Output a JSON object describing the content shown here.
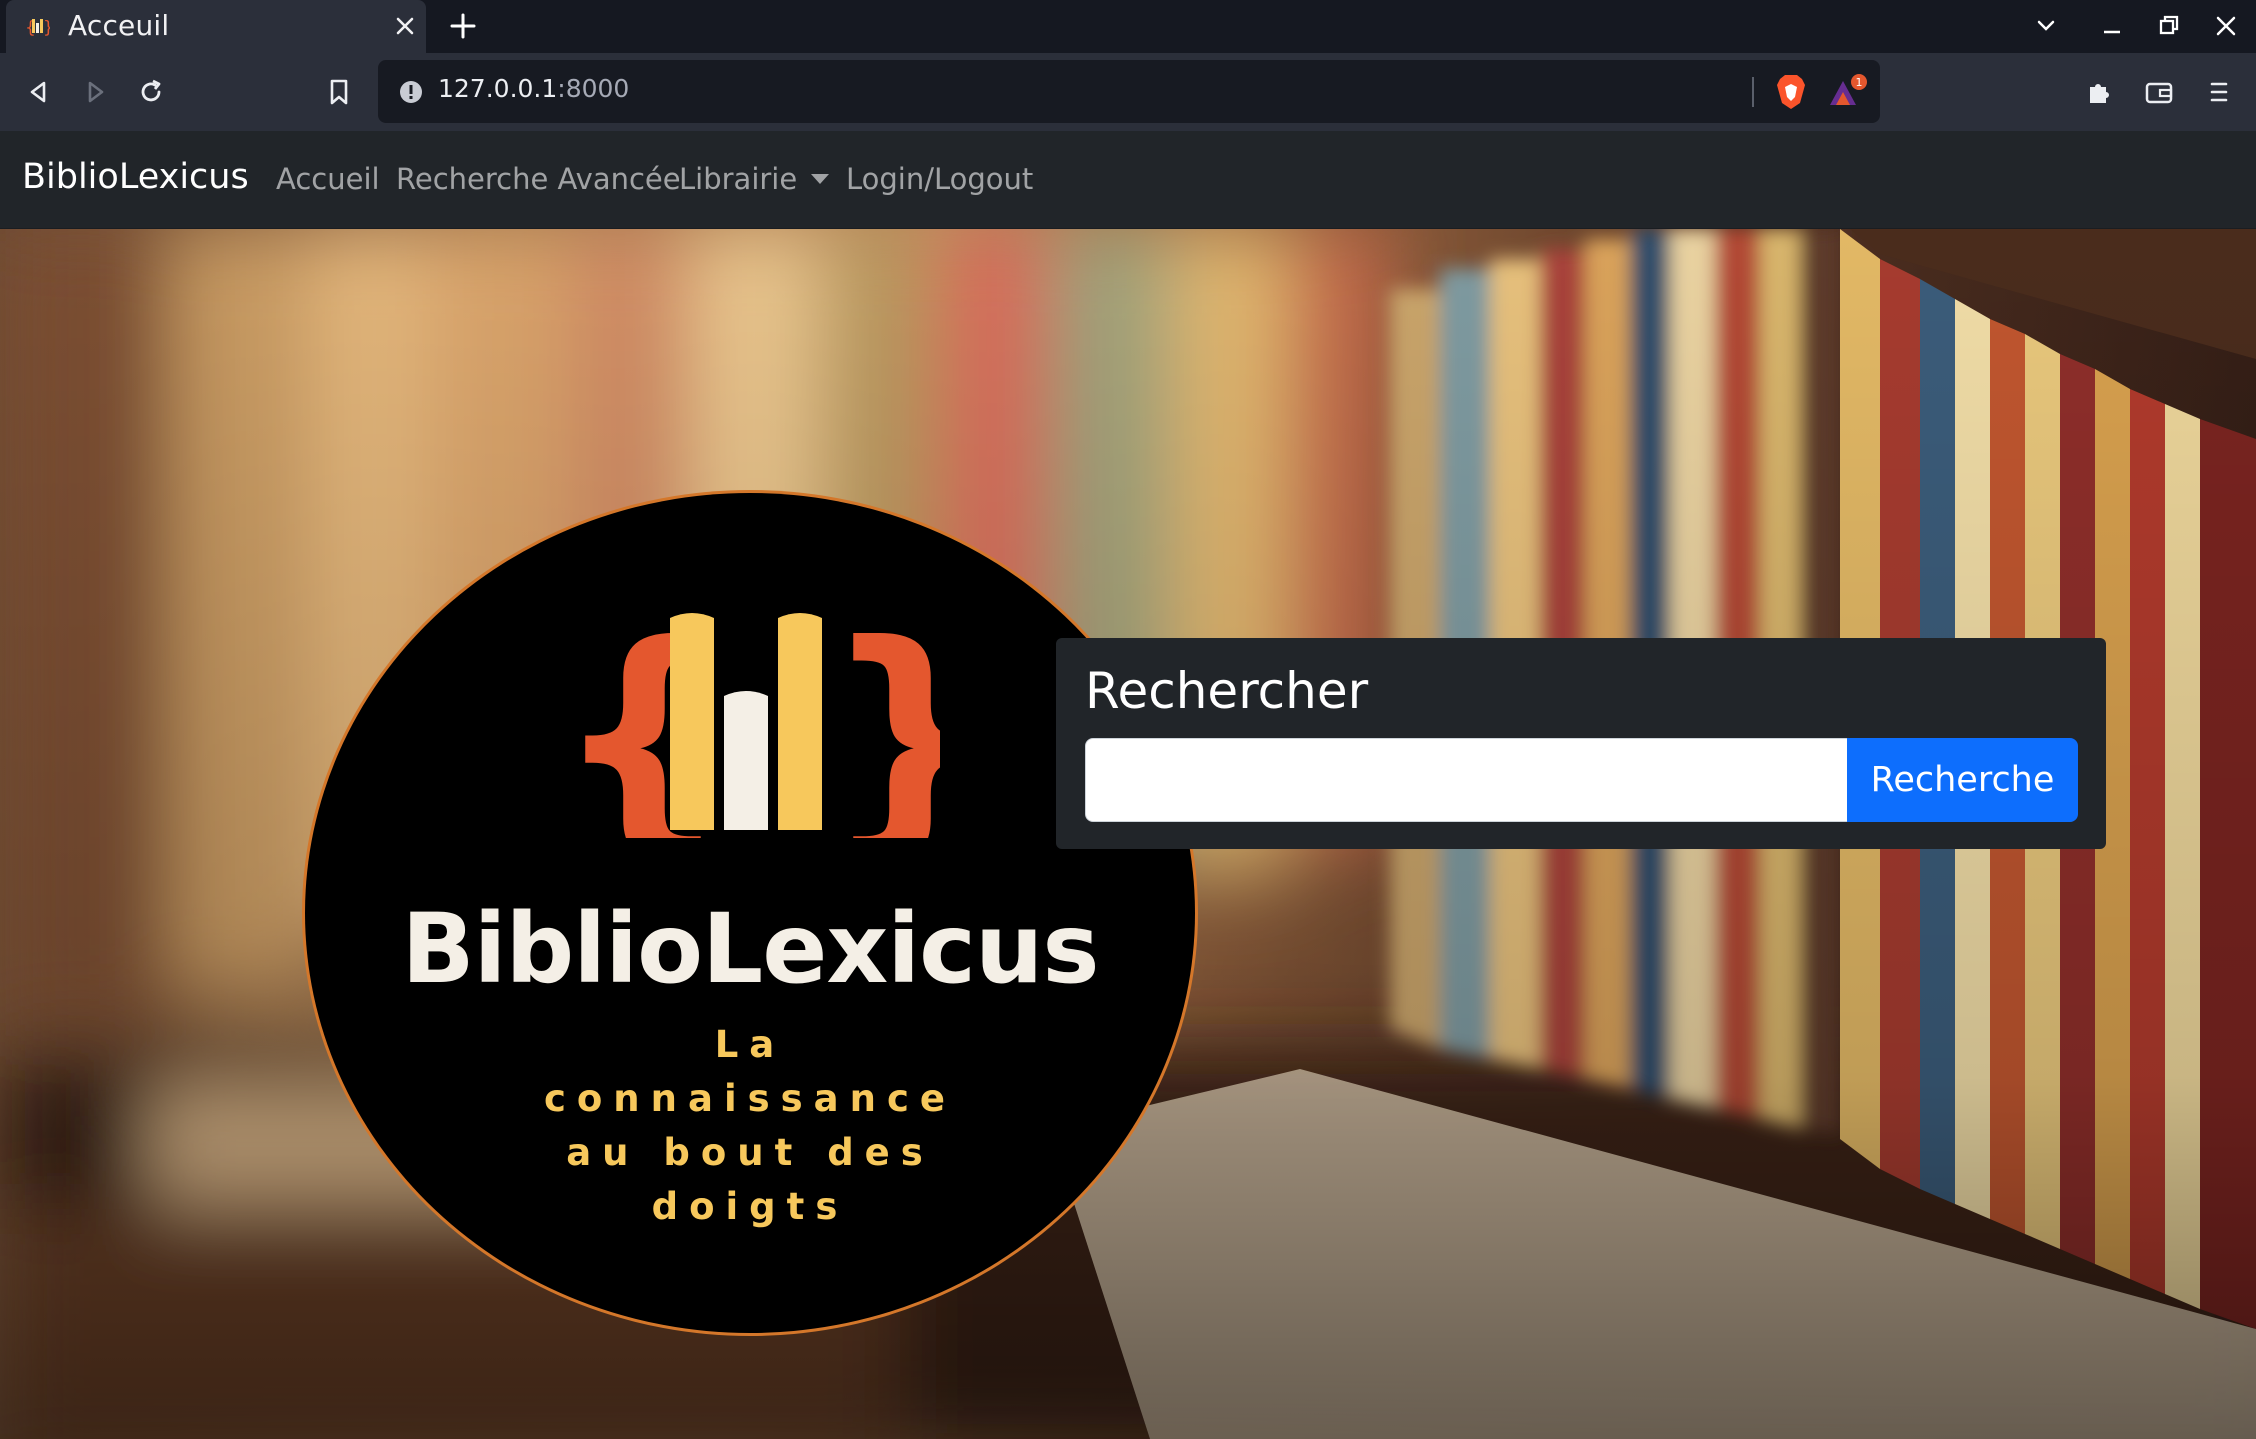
{
  "browser": {
    "tab": {
      "title": "Acceuil",
      "favicon": "bibliolexicus-favicon-icon"
    },
    "address": {
      "host": "127.0.0.1",
      "port": ":8000"
    },
    "rewards_badge": "1"
  },
  "navbar": {
    "brand": "BiblioLexicus",
    "links": [
      {
        "label": "Accueil"
      },
      {
        "label": "Recherche Avancée"
      },
      {
        "label": "Librairie",
        "dropdown": true
      },
      {
        "label": "Login/Logout"
      }
    ]
  },
  "logo": {
    "title": "BiblioLexicus",
    "tagline_lines": [
      "La connaissance",
      "au bout des",
      "doigts"
    ]
  },
  "search": {
    "heading": "Rechercher",
    "value": "",
    "button": "Recherche"
  },
  "colors": {
    "navbar_bg": "#212529",
    "primary_button": "#0d6efd",
    "logo_orange": "#e4572e",
    "logo_yellow": "#f7c85c"
  }
}
